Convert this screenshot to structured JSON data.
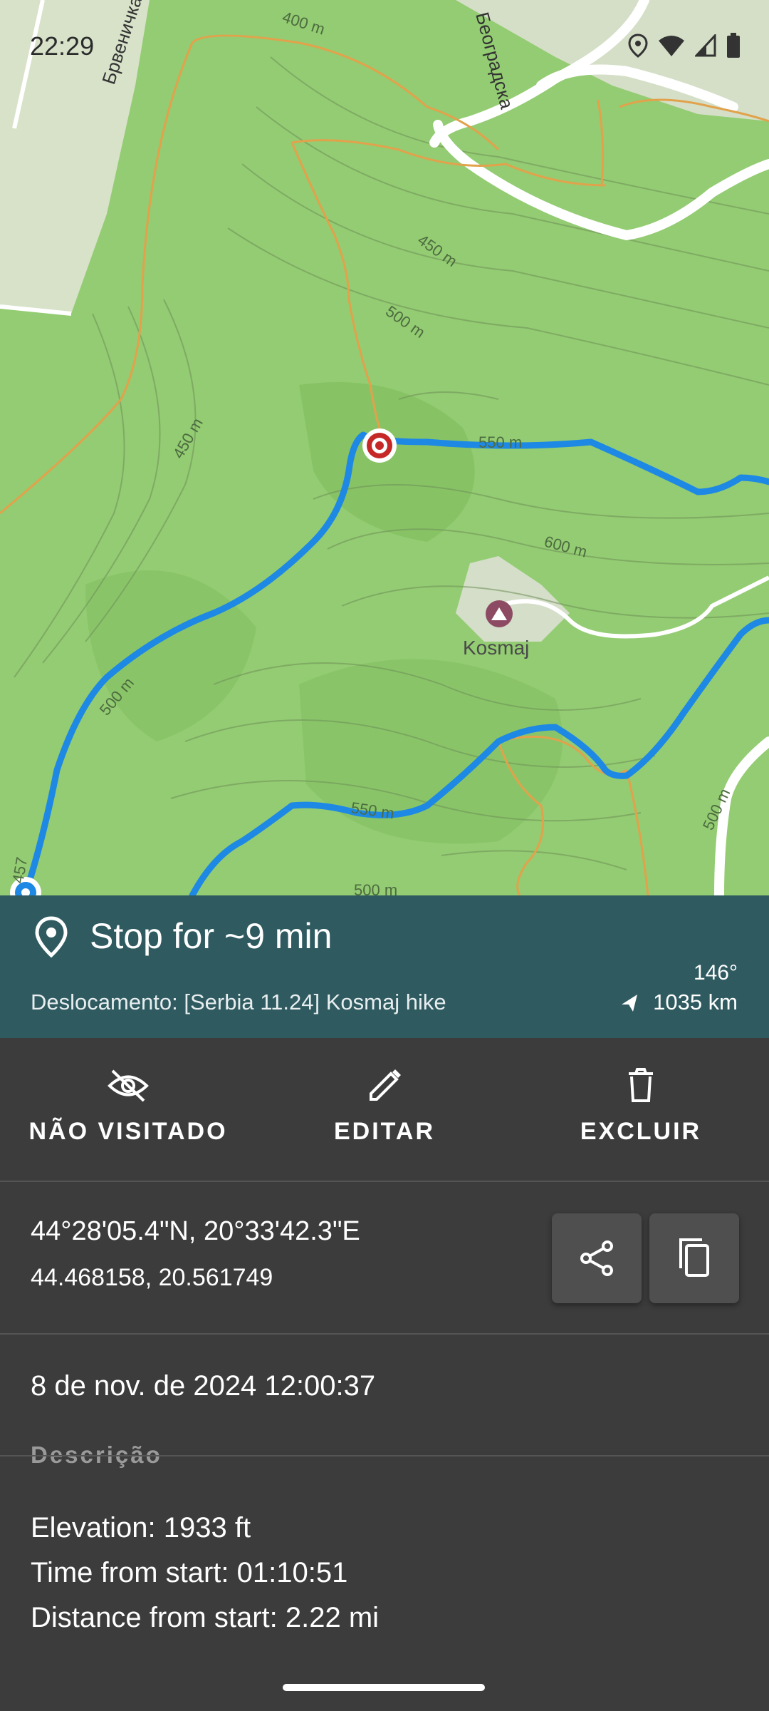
{
  "status_bar": {
    "time": "22:29"
  },
  "map": {
    "labels": {
      "contour_400": "400 m",
      "contour_450_top": "450 m",
      "contour_500_top": "500 m",
      "contour_450_left": "450 m",
      "contour_550_top": "550 m",
      "contour_600": "600 m",
      "contour_500_left": "500 m",
      "contour_550_bottom": "550 m",
      "contour_500_bottom": "500 m",
      "contour_500_right": "500 m",
      "peak_name": "Kosmaj",
      "road_bravnichka": "Брвеничка",
      "road_beogradska": "Београдска",
      "track_left": "457"
    },
    "colors": {
      "forest": "#8fca6e",
      "track": "#1e88e5",
      "trail": "#e8a64a",
      "road": "#ffffff",
      "waypoint": "#c62828"
    }
  },
  "header": {
    "title": "Stop for ~9 min",
    "subtitle": "Deslocamento: [Serbia 11.24] Kosmaj hike",
    "bearing": "146°",
    "distance": "1035 km"
  },
  "actions": [
    {
      "label": "NÃO VISITADO",
      "icon": "eye-off-icon"
    },
    {
      "label": "EDITAR",
      "icon": "pencil-icon"
    },
    {
      "label": "EXCLUIR",
      "icon": "trash-icon"
    }
  ],
  "coordinates": {
    "dms": "44°28'05.4\"N, 20°33'42.3\"E",
    "decimal": "44.468158, 20.561749"
  },
  "timestamp": "8 de nov. de 2024 12:00:37",
  "description": {
    "label": "Descrição",
    "lines": [
      "Elevation: 1933 ft",
      "Time from start: 01:10:51",
      "Distance from start: 2.22 mi"
    ]
  }
}
